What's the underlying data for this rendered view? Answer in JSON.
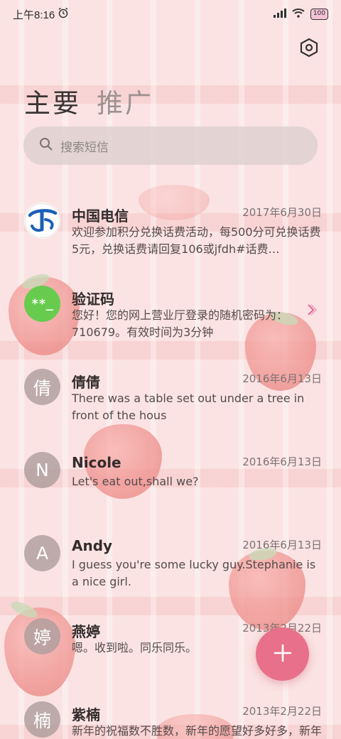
{
  "status_bar": {
    "time": "上午8:16",
    "battery": "100",
    "icons": [
      "alarm-icon",
      "signal-icon",
      "wifi-icon",
      "battery-icon"
    ]
  },
  "header": {
    "settings_icon": "settings-icon",
    "tabs": [
      {
        "label": "主要",
        "active": true
      },
      {
        "label": "推广",
        "active": false
      }
    ]
  },
  "search": {
    "placeholder": "搜索短信",
    "icon": "search-icon"
  },
  "conversations": [
    {
      "name": "中国电信",
      "date": "2017年6月30日",
      "preview": "欢迎参加积分兑换话费活动，每500分可兑换话费5元，兑换话费请回复106或jfdh#话费…",
      "avatar": "",
      "avatar_type": "logo"
    },
    {
      "name": "验证码",
      "date": "",
      "preview": "您好！您的网上营业厅登录的随机密码为：710679。有效时间为3分钟",
      "avatar": "**_",
      "avatar_type": "code"
    },
    {
      "name": "倩倩",
      "date": "2016年6月13日",
      "preview": "There was a table set out under a tree in front of the hous",
      "avatar": "倩",
      "avatar_type": "initial"
    },
    {
      "name": "Nicole",
      "date": "2016年6月13日",
      "preview": "Let's eat out,shall we?",
      "avatar": "N",
      "avatar_type": "initial"
    },
    {
      "name": "Andy",
      "date": "2016年6月13日",
      "preview": "I guess you're some lucky guy.Stephanie is a nice girl.",
      "avatar": "A",
      "avatar_type": "initial"
    },
    {
      "name": "燕婷",
      "date": "2013年2月22日",
      "preview": "嗯。收到啦。同乐同乐。",
      "avatar": "婷",
      "avatar_type": "initial"
    },
    {
      "name": "紫楠",
      "date": "2013年2月22日",
      "preview": "新年的祝福数不胜数，新年的愿望好多好多，新年的问候依旧美好，在这个温馨的时刻，…",
      "avatar": "楠",
      "avatar_type": "initial"
    }
  ],
  "fab": {
    "icon": "plus-icon"
  },
  "colors": {
    "accent": "#e8708a",
    "code_avatar": "#67cc4e",
    "telecom_blue": "#1b5fb8"
  }
}
